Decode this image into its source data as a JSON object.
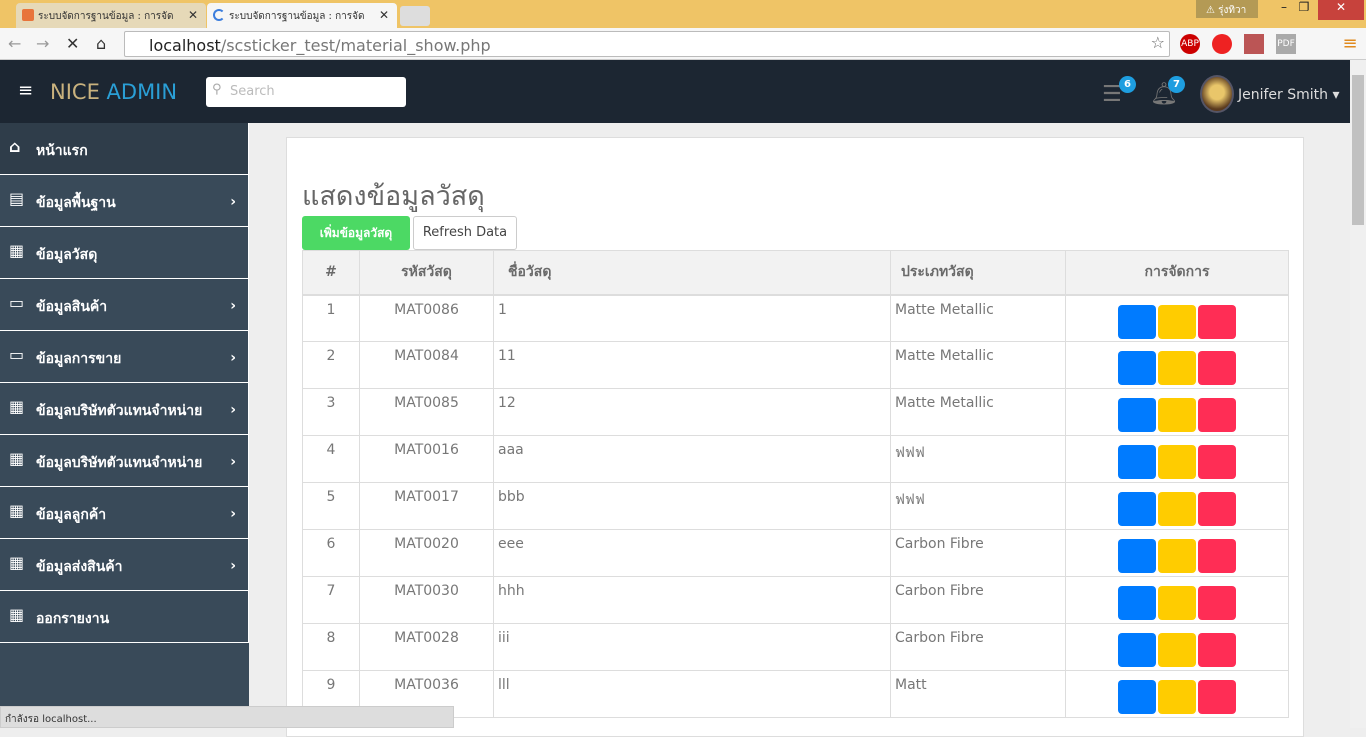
{
  "browser": {
    "tabs": [
      {
        "title": "ระบบจัดการฐานข้อมูล : การจัด"
      },
      {
        "title": "ระบบจัดการฐานข้อมูล : การจัด"
      }
    ],
    "warning": "รุ่งทิวา",
    "url_host": "localhost",
    "url_path": "/scsticker_test/material_show.php",
    "status": "กำลังรอ localhost..."
  },
  "header": {
    "logo_a": "NICE",
    "logo_b": "ADMIN",
    "search_placeholder": "Search",
    "tasks_count": "6",
    "notif_count": "7",
    "user": "Jenifer Smith"
  },
  "sidebar": {
    "items": [
      {
        "label": "หน้าแรก",
        "icon": "home-icon"
      },
      {
        "label": "ข้อมูลพื้นฐาน",
        "icon": "document-icon"
      },
      {
        "label": "ข้อมูลวัสดุ",
        "icon": "table-icon"
      },
      {
        "label": "ข้อมูลสินค้า",
        "icon": "monitor-icon"
      },
      {
        "label": "ข้อมูลการขาย",
        "icon": "monitor-icon"
      },
      {
        "label": "ข้อมูลบริษัทตัวแทนจำหน่าย",
        "icon": "table-icon"
      },
      {
        "label": "ข้อมูลบริษัทตัวแทนจำหน่าย",
        "icon": "table-icon"
      },
      {
        "label": "ข้อมูลลูกค้า",
        "icon": "table-icon"
      },
      {
        "label": "ข้อมูลส่งสินค้า",
        "icon": "table-icon"
      },
      {
        "label": "ออกรายงาน",
        "icon": "table-icon"
      }
    ]
  },
  "main": {
    "title": "แสดงข้อมูลวัสดุ",
    "add_label": "เพิ่มข้อมูลวัสดุ",
    "refresh_label": "Refresh Data",
    "columns": [
      "#",
      "รหัสวัสดุ",
      "ชื่อวัสดุ",
      "ประเภทวัสดุ",
      "การจัดการ"
    ],
    "rows": [
      [
        "1",
        "MAT0086",
        "1",
        "Matte Metallic"
      ],
      [
        "2",
        "MAT0084",
        "11",
        "Matte Metallic"
      ],
      [
        "3",
        "MAT0085",
        "12",
        "Matte Metallic"
      ],
      [
        "4",
        "MAT0016",
        "aaa",
        "ฟฟฟ"
      ],
      [
        "5",
        "MAT0017",
        "bbb",
        "ฟฟฟ"
      ],
      [
        "6",
        "MAT0020",
        "eee",
        "Carbon Fibre"
      ],
      [
        "7",
        "MAT0030",
        "hhh",
        "Carbon Fibre"
      ],
      [
        "8",
        "MAT0028",
        "iii",
        "Carbon Fibre"
      ],
      [
        "9",
        "MAT0036",
        "lll",
        "Matt"
      ]
    ]
  },
  "colors": {
    "view": "#007bff",
    "edit": "#ffcc00",
    "delete": "#ff2d55"
  }
}
